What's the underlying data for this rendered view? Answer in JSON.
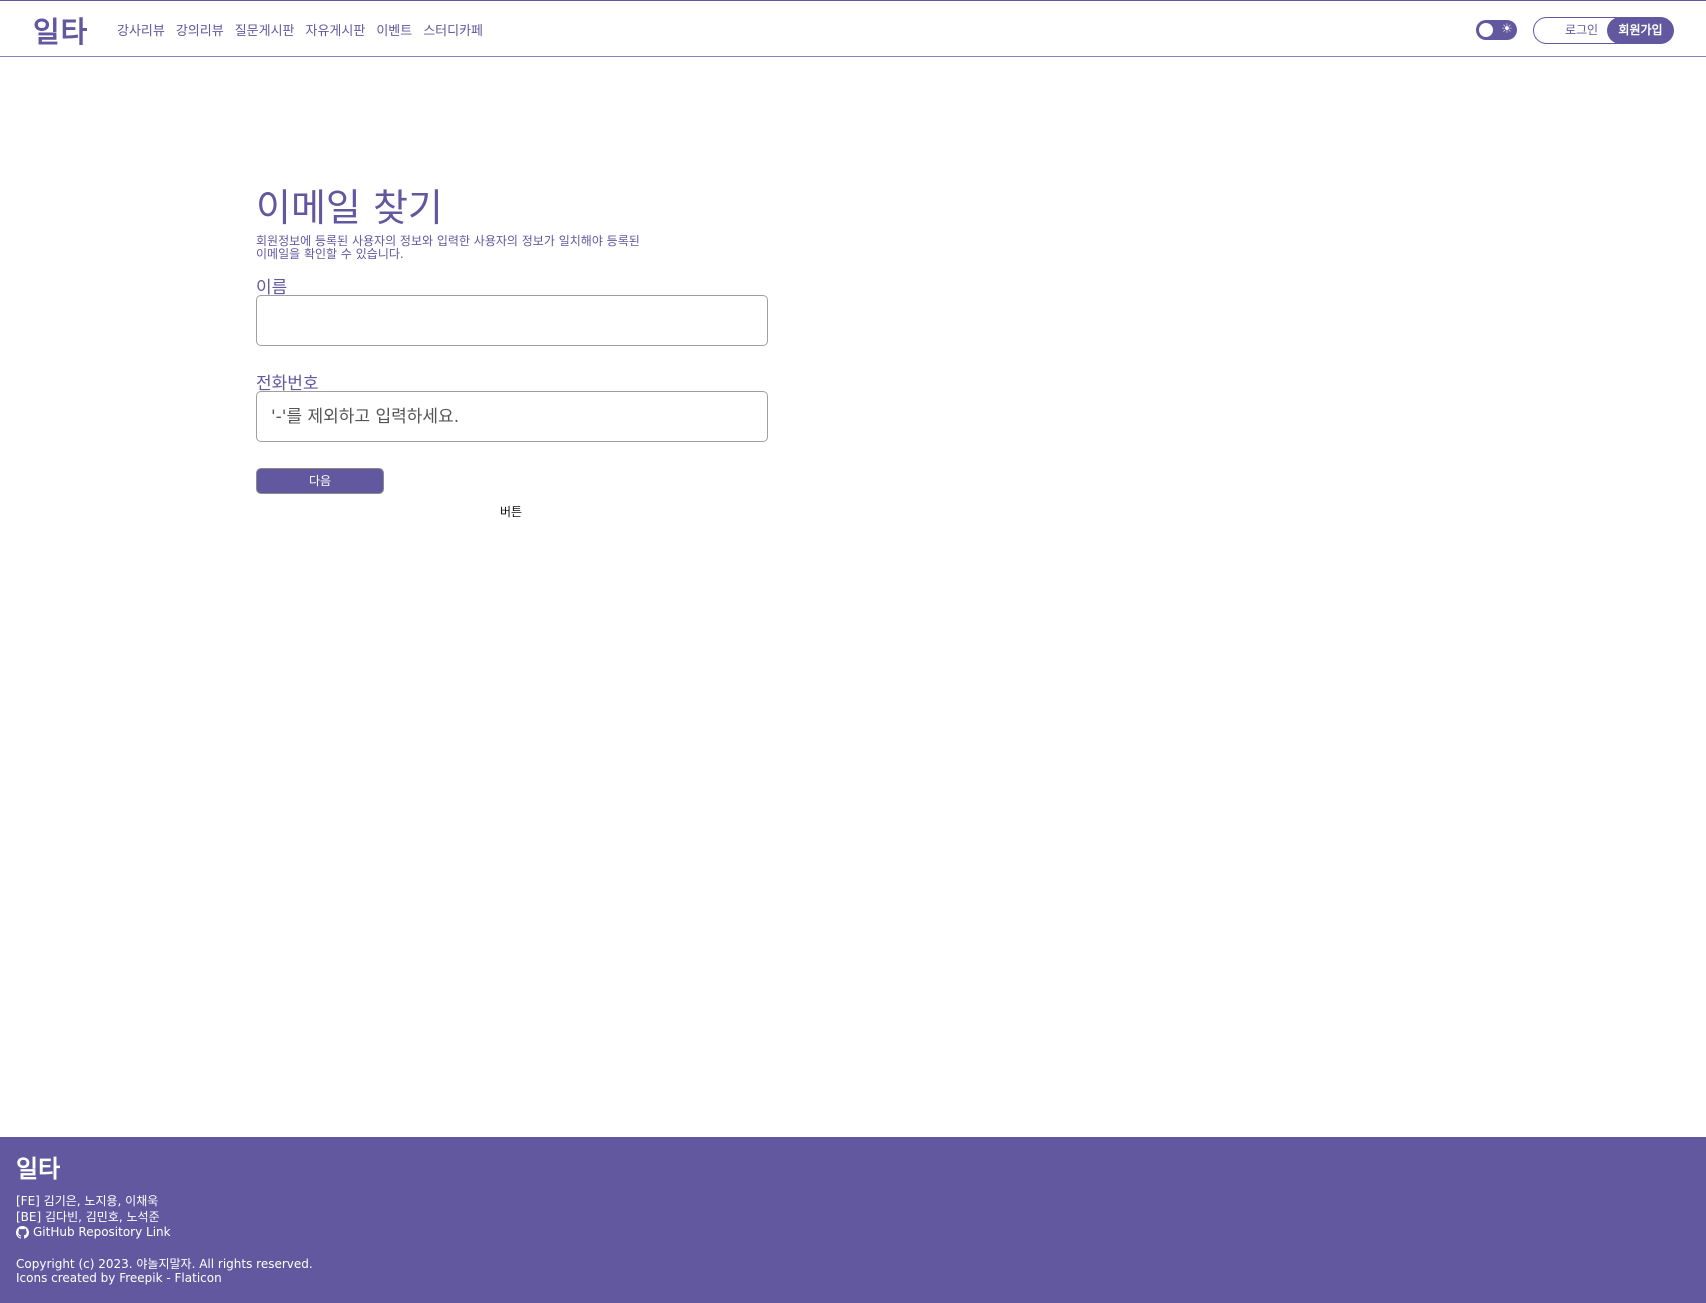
{
  "header": {
    "logo": "일타",
    "nav": [
      "강사리뷰",
      "강의리뷰",
      "질문게시판",
      "자유게시판",
      "이벤트",
      "스터디카페"
    ],
    "theme_toggle_icon": "sun-icon",
    "login_label": "로그인",
    "signup_label": "회원가입"
  },
  "main": {
    "title": "이메일 찾기",
    "description": "회원정보에 등록된 사용자의 정보와 입력한 사용자의 정보가 일치해야 등록된 이메일을 확인할 수 있습니다.",
    "name_label": "이름",
    "name_value": "",
    "name_placeholder": "",
    "phone_label": "전화번호",
    "phone_value": "",
    "phone_placeholder": "'-'를 제외하고 입력하세요.",
    "next_label": "다음",
    "button_caption": "버튼"
  },
  "footer": {
    "logo": "일타",
    "fe_team": "[FE] 김기은, 노지용, 이채욱",
    "be_team": "[BE] 김다빈, 김민호, 노석준",
    "github_icon": "github-icon",
    "github_link": "GitHub Repository Link",
    "copyright": "Copyright (c) 2023. 야놀지말자. All rights reserved.",
    "icons_credit": "Icons created by Freepik - Flaticon"
  },
  "colors": {
    "brand": "#62589f",
    "background": "#ffffff",
    "footer_text": "#ffffff"
  }
}
